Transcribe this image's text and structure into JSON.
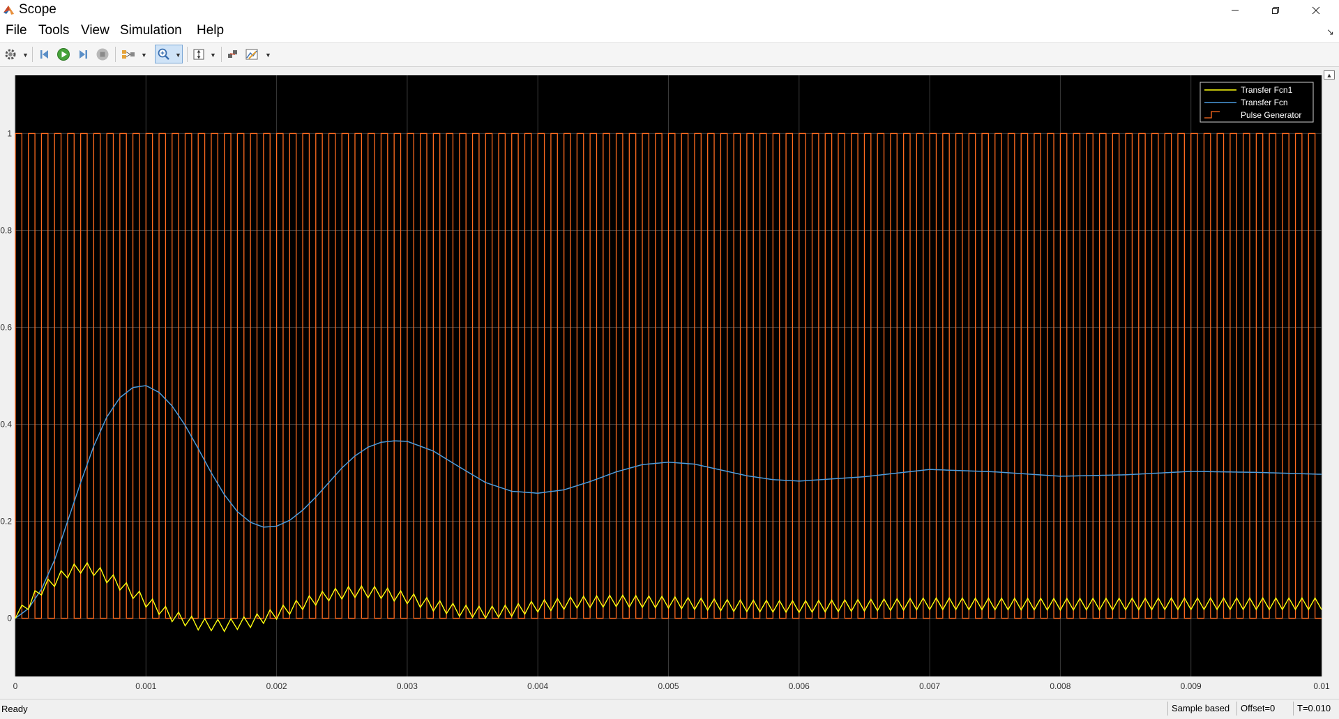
{
  "window": {
    "title": "Scope"
  },
  "menu": [
    "File",
    "Tools",
    "View",
    "Simulation",
    "Help"
  ],
  "toolbar": {
    "buttons": [
      "settings-icon",
      "step-back-icon",
      "run-icon",
      "step-forward-icon",
      "stop-icon",
      "signal-selector-icon",
      "zoom-icon",
      "autoscale-icon",
      "highlight-icon",
      "cursor-measure-icon"
    ]
  },
  "status": {
    "ready": "Ready",
    "sample": "Sample based",
    "offset": "Offset=0",
    "time": "T=0.010"
  },
  "colors": {
    "series_yellow": "#ffff0d",
    "series_blue": "#4b9bdc",
    "series_orange": "#ff6b1f",
    "plot_bg": "#000000",
    "grid": "#3a3a3a"
  },
  "chart_data": {
    "type": "line",
    "title": "",
    "xlabel": "",
    "ylabel": "",
    "xlim": [
      0,
      0.01
    ],
    "ylim": [
      -0.12,
      1.12
    ],
    "x_ticks": [
      "0",
      "0.001",
      "0.002",
      "0.003",
      "0.004",
      "0.005",
      "0.006",
      "0.007",
      "0.008",
      "0.009",
      "0.01"
    ],
    "y_ticks": [
      "0",
      "0.2",
      "0.4",
      "0.6",
      "0.8",
      "1"
    ],
    "x_tick_values": [
      0,
      0.001,
      0.002,
      0.003,
      0.004,
      0.005,
      0.006,
      0.007,
      0.008,
      0.009,
      0.01
    ],
    "y_tick_values": [
      0,
      0.2,
      0.4,
      0.6,
      0.8,
      1
    ],
    "grid": true,
    "legend_position": "top-right",
    "series": [
      {
        "name": "Transfer Fcn1",
        "color": "#ffff0d",
        "x": [
          0,
          0.0002,
          0.0004,
          0.0005,
          0.0006,
          0.0008,
          0.001,
          0.0012,
          0.0014,
          0.0016,
          0.0018,
          0.002,
          0.0022,
          0.0024,
          0.0026,
          0.0028,
          0.003,
          0.0032,
          0.0034,
          0.0036,
          0.0038,
          0.004,
          0.0043,
          0.0046,
          0.005,
          0.0055,
          0.006,
          0.0065,
          0.007,
          0.008,
          0.009,
          0.01
        ],
        "values": [
          0,
          0.06,
          0.095,
          0.105,
          0.1,
          0.07,
          0.035,
          0.005,
          -0.012,
          -0.015,
          -0.007,
          0.01,
          0.03,
          0.048,
          0.055,
          0.053,
          0.042,
          0.027,
          0.016,
          0.012,
          0.016,
          0.025,
          0.033,
          0.036,
          0.033,
          0.026,
          0.024,
          0.027,
          0.03,
          0.029,
          0.03,
          0.03
        ],
        "ripple_amplitude": 0.012
      },
      {
        "name": "Transfer Fcn",
        "color": "#4b9bdc",
        "x": [
          0,
          0.0001,
          0.0002,
          0.0003,
          0.0004,
          0.0005,
          0.0006,
          0.0007,
          0.0008,
          0.0009,
          0.001,
          0.0011,
          0.0012,
          0.0013,
          0.0014,
          0.0015,
          0.0016,
          0.0017,
          0.0018,
          0.0019,
          0.002,
          0.0021,
          0.0022,
          0.0023,
          0.0024,
          0.0025,
          0.0026,
          0.0027,
          0.0028,
          0.0029,
          0.003,
          0.0032,
          0.0034,
          0.0036,
          0.0038,
          0.004,
          0.0042,
          0.0044,
          0.0046,
          0.0048,
          0.005,
          0.0052,
          0.0054,
          0.0056,
          0.0058,
          0.006,
          0.0065,
          0.007,
          0.0075,
          0.008,
          0.0085,
          0.009,
          0.0095,
          0.01
        ],
        "values": [
          0,
          0.02,
          0.06,
          0.12,
          0.2,
          0.28,
          0.355,
          0.415,
          0.455,
          0.476,
          0.48,
          0.466,
          0.438,
          0.398,
          0.35,
          0.3,
          0.255,
          0.22,
          0.198,
          0.188,
          0.19,
          0.202,
          0.223,
          0.25,
          0.28,
          0.31,
          0.335,
          0.353,
          0.363,
          0.366,
          0.365,
          0.345,
          0.312,
          0.28,
          0.262,
          0.258,
          0.265,
          0.282,
          0.302,
          0.317,
          0.322,
          0.318,
          0.306,
          0.294,
          0.286,
          0.283,
          0.292,
          0.307,
          0.302,
          0.293,
          0.296,
          0.303,
          0.301,
          0.297
        ]
      },
      {
        "name": "Pulse Generator",
        "color": "#ff6b1f",
        "style": "square wave",
        "period": 0.0001,
        "duty": 0.5,
        "low": 0,
        "high": 1
      }
    ]
  }
}
